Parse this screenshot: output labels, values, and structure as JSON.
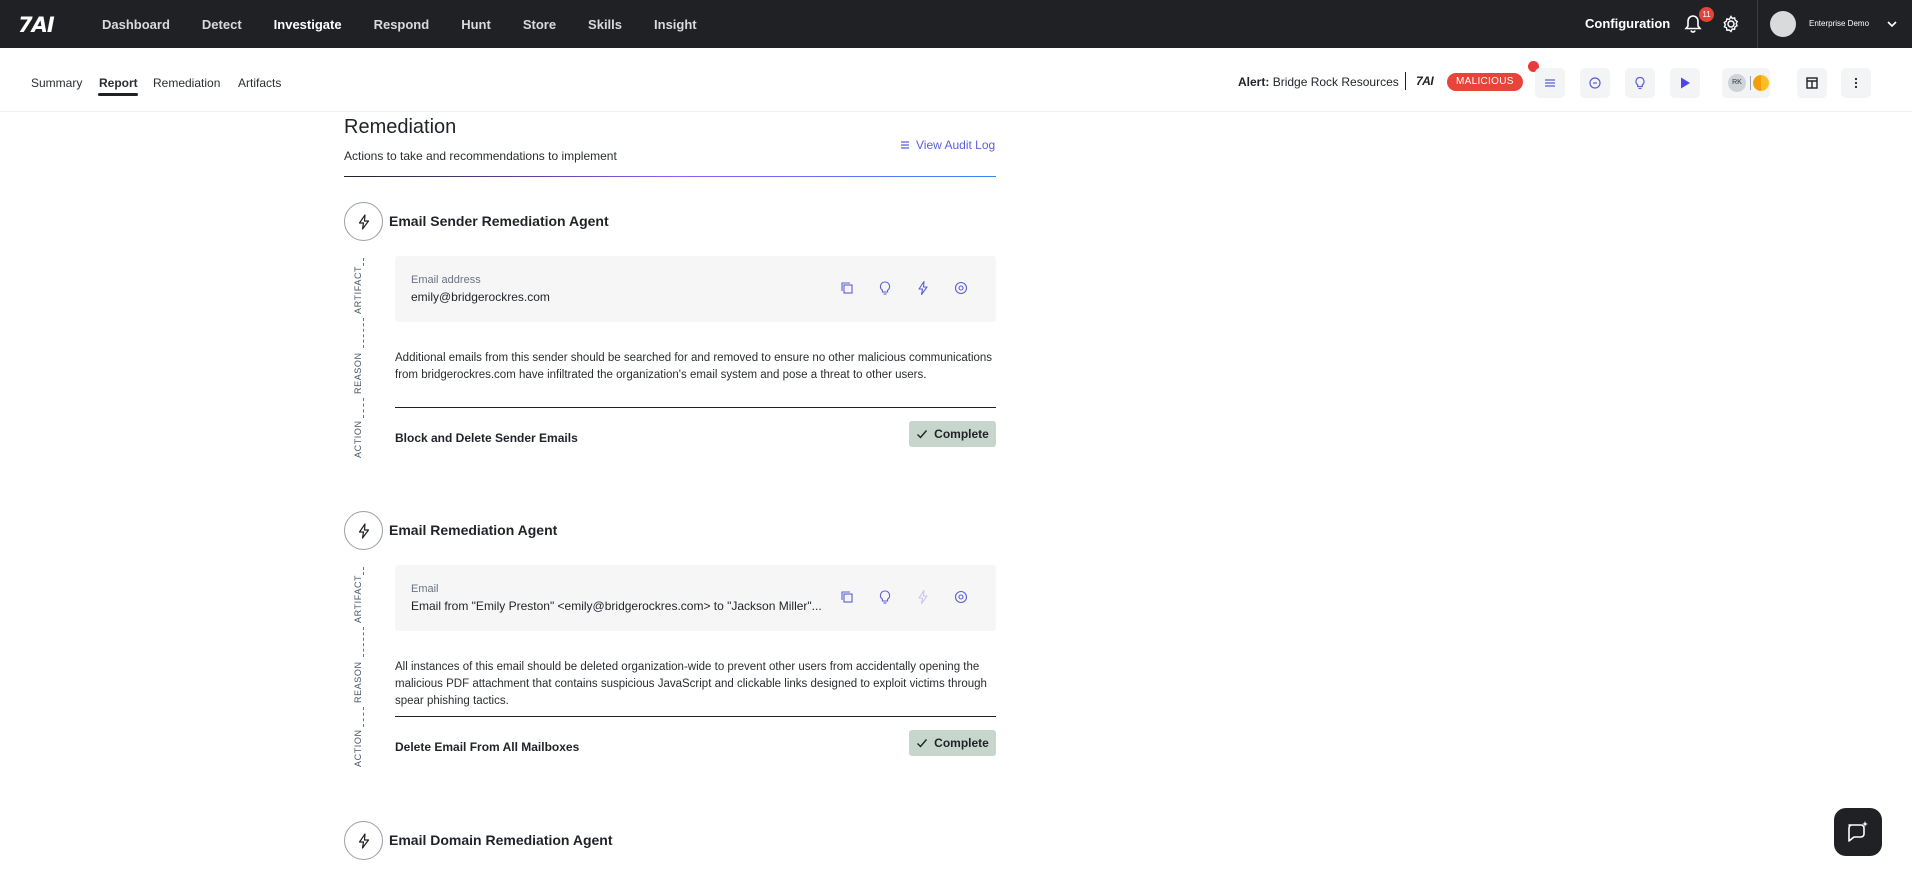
{
  "topnav": {
    "logo": "7AI",
    "items": [
      "Dashboard",
      "Detect",
      "Investigate",
      "Respond",
      "Hunt",
      "Store",
      "Skills",
      "Insight"
    ],
    "active": "Investigate",
    "configuration": "Configuration",
    "notification_count": "11",
    "user_name": "Enterprise Demo"
  },
  "subnav": {
    "tabs": [
      "Summary",
      "Report",
      "Remediation",
      "Artifacts"
    ],
    "active_tab": "Report",
    "alert_prefix": "Alert:",
    "alert_name": "Bridge Rock Resources",
    "small_logo": "7AI",
    "verdict": "MALICIOUS",
    "user_initials": "RK"
  },
  "page": {
    "title": "Remediation",
    "subtitle": "Actions to take and recommendations to implement",
    "audit_link": "View Audit Log"
  },
  "side_labels": {
    "artifact": "ARTIFACT",
    "reason": "REASON",
    "action": "ACTION"
  },
  "agents": [
    {
      "title": "Email Sender Remediation Agent",
      "artifact_type": "Email address",
      "artifact_value": "emily@bridgerockres.com",
      "reason": "Additional emails from this sender should be searched for and removed to ensure no other malicious communications from bridgerockres.com have infiltrated the organization's email system and pose a threat to other users.",
      "action": "Block and Delete Sender Emails",
      "status": "Complete"
    },
    {
      "title": "Email Remediation Agent",
      "artifact_type": "Email",
      "artifact_value": "Email from \"Emily Preston\" <emily@bridgerockres.com> to \"Jackson Miller\"...",
      "reason": "All instances of this email should be deleted organization-wide to prevent other users from accidentally opening the malicious PDF attachment that contains suspicious JavaScript and clickable links designed to exploit victims through spear phishing tactics.",
      "action": "Delete Email From All Mailboxes",
      "status": "Complete"
    },
    {
      "title": "Email Domain Remediation Agent"
    }
  ],
  "colors": {
    "topbar": "#1f2125",
    "malicious": "#e8443a",
    "link": "#5a5fd6",
    "complete_bg": "#c7d6cd"
  }
}
